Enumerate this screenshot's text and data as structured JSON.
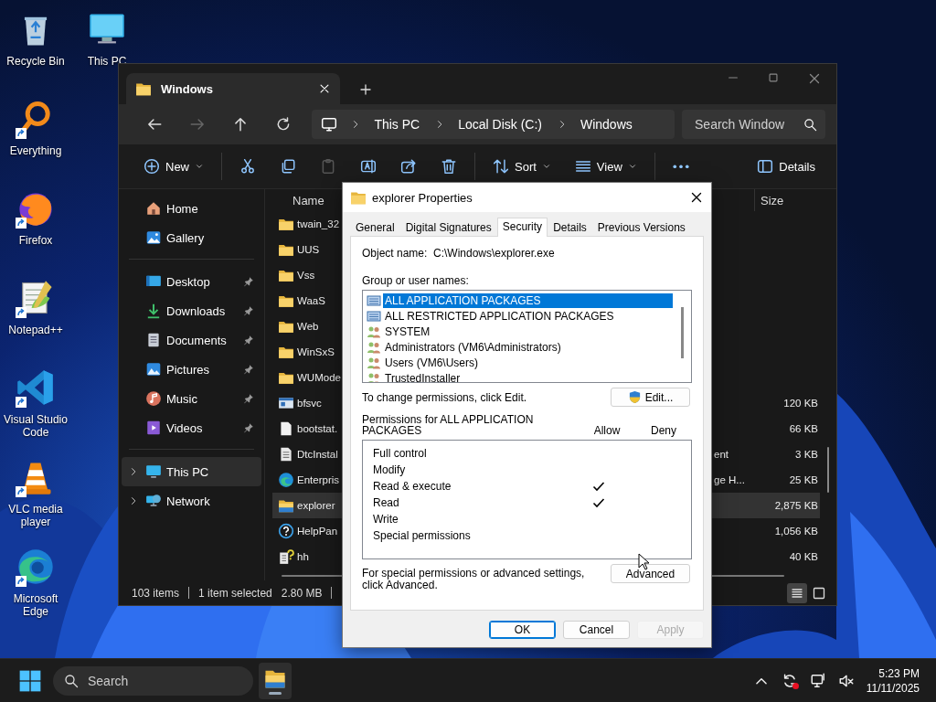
{
  "desktop_icons": [
    {
      "label": "Recycle Bin",
      "kind": "recycle_bin",
      "shortcut": false
    },
    {
      "label": "Everything",
      "kind": "everything",
      "shortcut": true
    },
    {
      "label": "Firefox",
      "kind": "firefox",
      "shortcut": true
    },
    {
      "label": "Notepad++",
      "kind": "notepad",
      "shortcut": true
    },
    {
      "label": "Visual Studio Code",
      "kind": "vscode",
      "shortcut": true
    },
    {
      "label": "VLC media player",
      "kind": "vlc",
      "shortcut": true
    },
    {
      "label": "Microsoft Edge",
      "kind": "edge",
      "shortcut": true
    },
    {
      "label": "This PC",
      "kind": "this_pc",
      "shortcut": false
    }
  ],
  "explorer": {
    "tabs": [
      {
        "title": "Windows",
        "selected": true
      }
    ],
    "nav_buttons": [
      {
        "kind": "back",
        "disabled": false
      },
      {
        "kind": "forward",
        "disabled": true
      },
      {
        "kind": "up",
        "disabled": false
      },
      {
        "kind": "refresh",
        "disabled": false
      }
    ],
    "breadcrumb": [
      "This PC",
      "Local Disk (C:)",
      "Windows"
    ],
    "search": {
      "placeholder": "Search Window"
    },
    "toolbar": [
      {
        "kind": "new",
        "label": "New",
        "dropdown": true,
        "disabled": false
      },
      {
        "kind": "cut",
        "dropdown": false,
        "disabled": false
      },
      {
        "kind": "copy",
        "dropdown": false,
        "disabled": false
      },
      {
        "kind": "paste",
        "dropdown": false,
        "disabled": true
      },
      {
        "kind": "rename",
        "dropdown": false,
        "disabled": false
      },
      {
        "kind": "share",
        "dropdown": false,
        "disabled": false
      },
      {
        "kind": "delete",
        "dropdown": false,
        "disabled": false
      },
      {
        "kind": "sort",
        "label": "Sort",
        "dropdown": true,
        "disabled": false
      },
      {
        "kind": "view",
        "label": "View",
        "dropdown": true,
        "disabled": false
      },
      {
        "kind": "more",
        "dropdown": false,
        "disabled": false
      },
      {
        "kind": "details",
        "label": "Details",
        "dropdown": false,
        "disabled": false
      }
    ],
    "nav_groups": [
      {
        "items": [
          {
            "label": "Home",
            "kind": "home",
            "pinned": false,
            "expandable": false,
            "selected": false
          },
          {
            "label": "Gallery",
            "kind": "gallery",
            "pinned": false,
            "expandable": false,
            "selected": false
          }
        ]
      },
      {
        "items": [
          {
            "label": "Desktop",
            "kind": "desktop",
            "pinned": true,
            "expandable": false,
            "selected": false
          },
          {
            "label": "Downloads",
            "kind": "downloads",
            "pinned": true,
            "expandable": false,
            "selected": false
          },
          {
            "label": "Documents",
            "kind": "documents",
            "pinned": true,
            "expandable": false,
            "selected": false
          },
          {
            "label": "Pictures",
            "kind": "pictures",
            "pinned": true,
            "expandable": false,
            "selected": false
          },
          {
            "label": "Music",
            "kind": "music",
            "pinned": true,
            "expandable": false,
            "selected": false
          },
          {
            "label": "Videos",
            "kind": "videos",
            "pinned": true,
            "expandable": false,
            "selected": false
          }
        ]
      },
      {
        "items": [
          {
            "label": "This PC",
            "kind": "this_pc",
            "pinned": false,
            "expandable": true,
            "selected": true
          },
          {
            "label": "Network",
            "kind": "network",
            "pinned": false,
            "expandable": true,
            "selected": false
          }
        ]
      }
    ],
    "columns": [
      "Name",
      "Size"
    ],
    "files": [
      {
        "name": "twain_32",
        "kind": "folder",
        "selected": false
      },
      {
        "name": "UUS",
        "kind": "folder",
        "selected": false
      },
      {
        "name": "Vss",
        "kind": "folder",
        "selected": false
      },
      {
        "name": "WaaS",
        "kind": "folder",
        "selected": false
      },
      {
        "name": "Web",
        "kind": "folder",
        "selected": false
      },
      {
        "name": "WinSxS",
        "kind": "folder",
        "selected": false
      },
      {
        "name": "WUMode",
        "kind": "folder",
        "selected": false
      },
      {
        "name": "bfsvc",
        "kind": "app",
        "size": "120 KB",
        "selected": false
      },
      {
        "name": "bootstat.",
        "kind": "file",
        "size": "66 KB",
        "selected": false
      },
      {
        "name": "DtcInstal",
        "kind": "text",
        "column_2": "ent",
        "size": "3 KB",
        "selected": false
      },
      {
        "name": "Enterpris",
        "kind": "edge",
        "column_2": "ge H...",
        "size": "25 KB",
        "selected": false
      },
      {
        "name": "explorer",
        "kind": "explorer",
        "size": "2,875 KB",
        "selected": true
      },
      {
        "name": "HelpPan",
        "kind": "help",
        "size": "1,056 KB",
        "selected": false
      },
      {
        "name": "hh",
        "kind": "hh",
        "size": "40 KB",
        "selected": false
      }
    ],
    "status": {
      "count": "103 items",
      "selection": "1 item selected",
      "selection_size": "2.80 MB"
    },
    "view_modes": [
      {
        "kind": "details",
        "selected": true
      },
      {
        "kind": "tiles",
        "selected": false
      }
    ]
  },
  "dialog": {
    "title": "explorer Properties",
    "tabs": [
      {
        "label": "General",
        "selected": false
      },
      {
        "label": "Digital Signatures",
        "selected": false
      },
      {
        "label": "Security",
        "selected": true
      },
      {
        "label": "Details",
        "selected": false
      },
      {
        "label": "Previous Versions",
        "selected": false
      }
    ],
    "object_name_label": "Object name:",
    "object_name": "C:\\Windows\\explorer.exe",
    "groups_label": "Group or user names:",
    "principals": [
      {
        "name": "ALL APPLICATION PACKAGES",
        "kind": "package",
        "selected": true
      },
      {
        "name": "ALL RESTRICTED APPLICATION PACKAGES",
        "kind": "package",
        "selected": false
      },
      {
        "name": "SYSTEM",
        "kind": "group",
        "selected": false
      },
      {
        "name": "Administrators (VM6\\Administrators)",
        "kind": "group",
        "selected": false
      },
      {
        "name": "Users (VM6\\Users)",
        "kind": "group",
        "selected": false
      },
      {
        "name": "TrustedInstaller",
        "kind": "group",
        "selected": false
      }
    ],
    "change_hint": "To change permissions, click Edit.",
    "edit_button": "Edit...",
    "permissions_label": "Permissions for ALL APPLICATION PACKAGES",
    "allow_header": "Allow",
    "deny_header": "Deny",
    "permissions": [
      {
        "name": "Full control",
        "allow": false,
        "deny": false
      },
      {
        "name": "Modify",
        "allow": false,
        "deny": false
      },
      {
        "name": "Read & execute",
        "allow": true,
        "deny": false
      },
      {
        "name": "Read",
        "allow": true,
        "deny": false
      },
      {
        "name": "Write",
        "allow": false,
        "deny": false
      },
      {
        "name": "Special permissions",
        "allow": false,
        "deny": false
      }
    ],
    "advanced_hint": "For special permissions or advanced settings, click Advanced.",
    "advanced_button": "Advanced",
    "buttons": [
      {
        "label": "OK",
        "default": true,
        "disabled": false
      },
      {
        "label": "Cancel",
        "default": false,
        "disabled": false
      },
      {
        "label": "Apply",
        "default": false,
        "disabled": true
      }
    ]
  },
  "taskbar": {
    "search": {
      "placeholder": "Search"
    },
    "apps": [
      {
        "kind": "file_explorer",
        "active": true
      }
    ],
    "tray": [
      {
        "kind": "chevron",
        "alert": false
      },
      {
        "kind": "sync",
        "alert": true
      },
      {
        "kind": "network",
        "alert": false
      },
      {
        "kind": "volume_muted",
        "alert": false
      }
    ],
    "time": "5:23 PM",
    "date": "11/11/2025"
  }
}
